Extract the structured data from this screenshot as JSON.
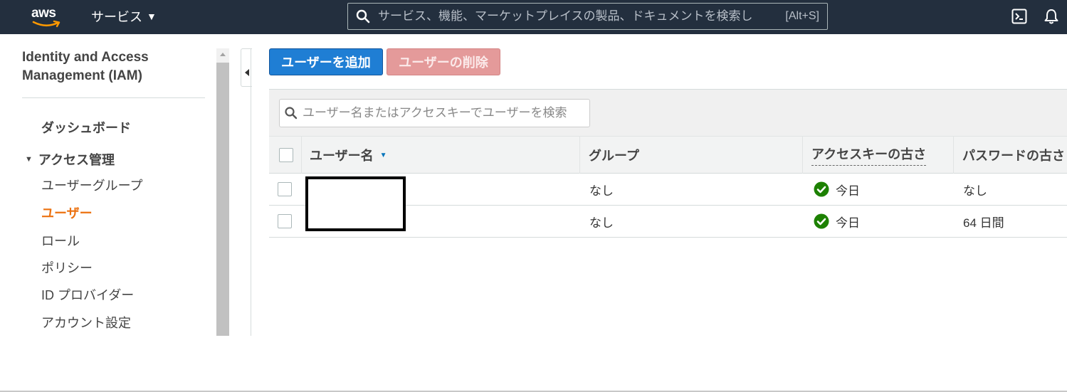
{
  "topnav": {
    "logo_text": "aws",
    "services_label": "サービス",
    "search_placeholder": "サービス、機能、マーケットプレイスの製品、ドキュメントを検索し",
    "search_shortcut": "[Alt+S]",
    "icons": [
      "search-icon",
      "cloudshell-icon",
      "bell-icon"
    ],
    "bg_color": "#232f3e"
  },
  "sidebar": {
    "title": "Identity and Access Management (IAM)",
    "dashboard": "ダッシュボード",
    "section_label": "アクセス管理",
    "items": [
      {
        "label": "ユーザーグループ",
        "active": false
      },
      {
        "label": "ユーザー",
        "active": true
      },
      {
        "label": "ロール",
        "active": false
      },
      {
        "label": "ポリシー",
        "active": false
      },
      {
        "label": "ID プロバイダー",
        "active": false
      },
      {
        "label": "アカウント設定",
        "active": false
      }
    ],
    "active_color": "#ec7211"
  },
  "toolbar": {
    "add_user_label": "ユーザーを追加",
    "delete_user_label": "ユーザーの削除",
    "primary_color": "#1f7ed4"
  },
  "user_search": {
    "placeholder": "ユーザー名またはアクセスキーでユーザーを検索"
  },
  "table": {
    "columns": [
      "ユーザー名",
      "グループ",
      "アクセスキーの古さ",
      "パスワードの古さ"
    ],
    "sorted_column": "ユーザー名",
    "rows": [
      {
        "username": "",
        "group": "なし",
        "access_key_age": "今日",
        "password_age": "なし"
      },
      {
        "username": "",
        "group": "なし",
        "access_key_age": "今日",
        "password_age": "64 日間"
      }
    ],
    "ok_color": "#1d8102"
  }
}
